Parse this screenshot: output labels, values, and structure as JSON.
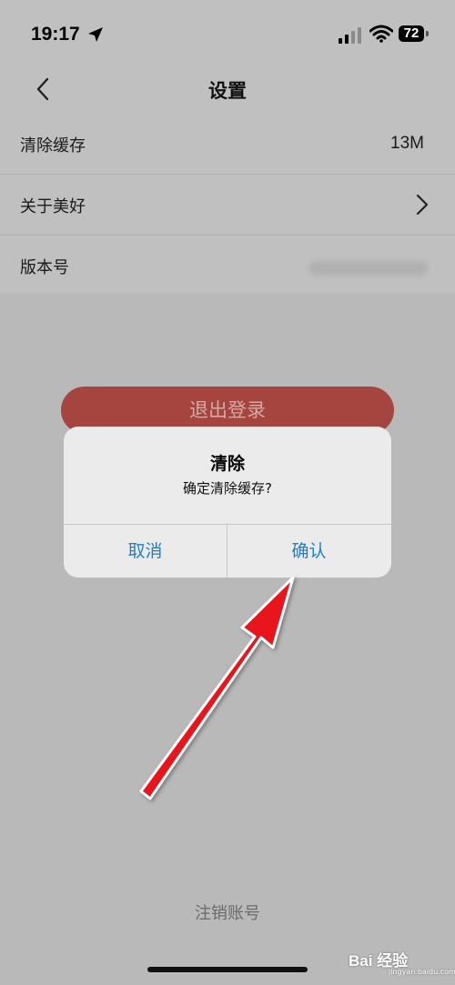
{
  "status": {
    "time": "19:17",
    "battery": "72"
  },
  "nav": {
    "title": "设置"
  },
  "settings": {
    "items": [
      {
        "label": "清除缓存",
        "value": "13M"
      },
      {
        "label": "关于美好"
      },
      {
        "label": "版本号"
      }
    ]
  },
  "logout_label": "退出登录",
  "dialog": {
    "title": "清除",
    "message": "确定清除缓存?",
    "cancel": "取消",
    "confirm": "确认"
  },
  "deactivate_label": "注销账号",
  "watermark": {
    "text": "Bai 经验",
    "sub": "jingyan.baidu.com"
  },
  "colors": {
    "accent": "#1f7ecd",
    "logout": "#a64440",
    "arrow": "#e8141a"
  }
}
